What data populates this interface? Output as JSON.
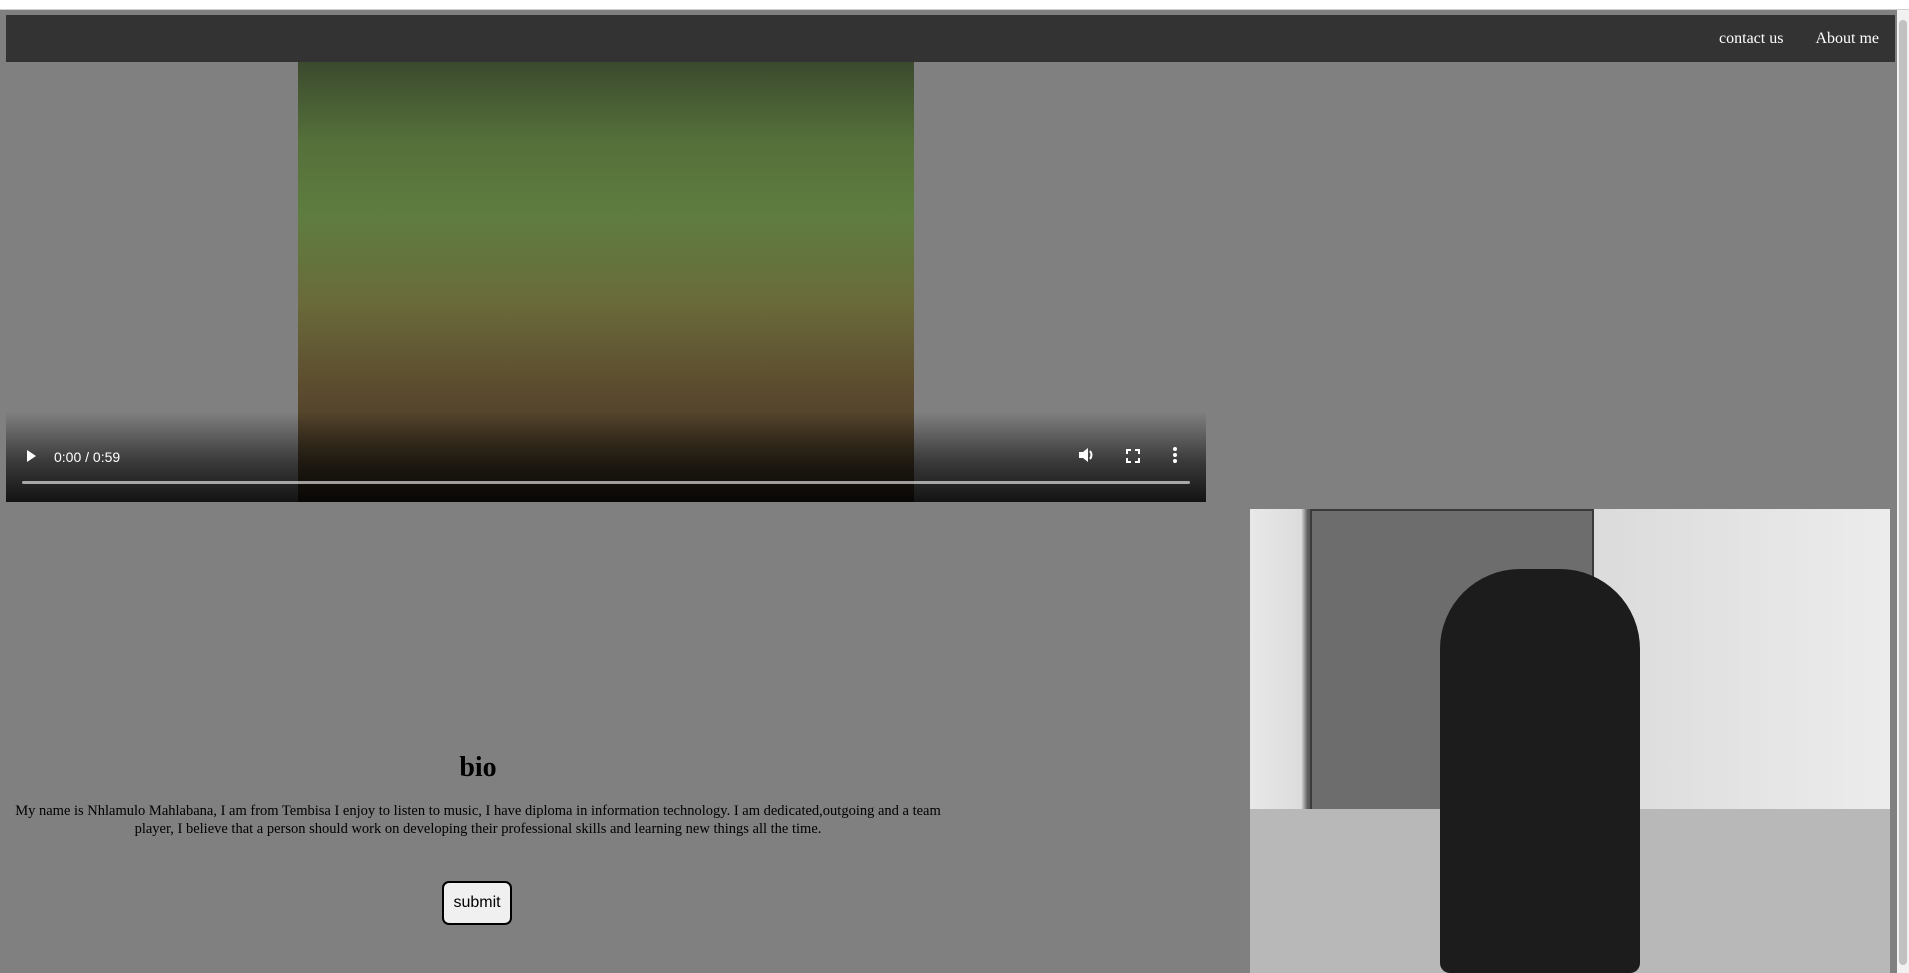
{
  "nav": {
    "links": [
      "contact us",
      "About me"
    ]
  },
  "video": {
    "time": "0:00 / 0:59",
    "progress_fraction": 0,
    "icons": [
      "play-icon",
      "volume-icon",
      "fullscreen-icon",
      "more-options-icon"
    ]
  },
  "bio": {
    "title": "bio",
    "text": "My name is Nhlamulo Mahlabana, I am from Tembisa I enjoy to listen to music, I have diploma in information technology. I am dedicated,outgoing and a team player, I believe that a person should work on developing their professional skills and learning new things all the time."
  },
  "form": {
    "submit_label": "submit"
  },
  "colors": {
    "page_bg": "#808080",
    "navbar_bg": "#333333",
    "nav_text": "#ffffff"
  }
}
